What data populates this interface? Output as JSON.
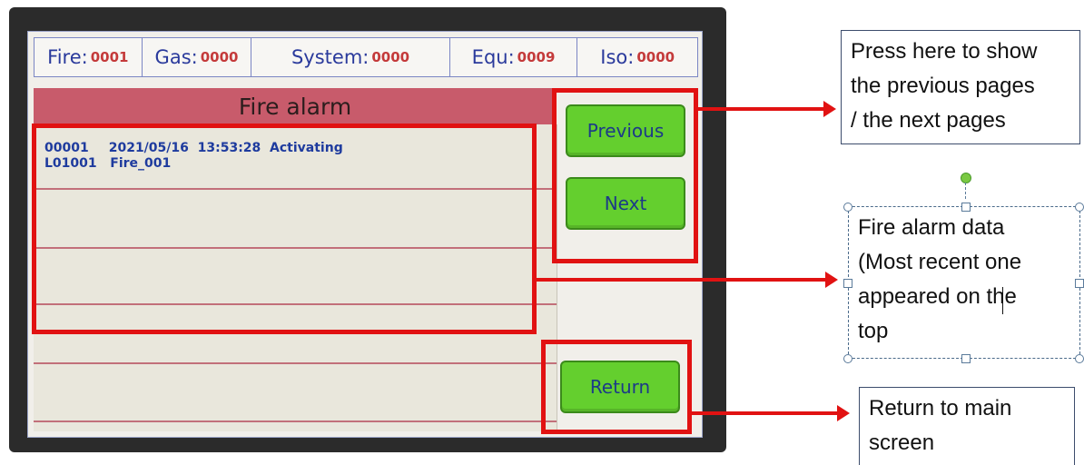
{
  "status_bar": {
    "fire": {
      "label": "Fire",
      "sep": ":",
      "value": "0001"
    },
    "gas": {
      "label": "Gas",
      "sep": ":",
      "value": "0000"
    },
    "system": {
      "label": "System",
      "sep": ":",
      "value": "0000"
    },
    "equ": {
      "label": "Equ",
      "sep": ":",
      "value": "0009"
    },
    "iso": {
      "label": "Iso",
      "sep": ":",
      "value": "0000"
    }
  },
  "panel": {
    "title": "Fire alarm",
    "entries": [
      {
        "id": "00001",
        "date": "2021/05/16",
        "time": "13:53:28",
        "state": "Activating",
        "location": "L01001",
        "name": "Fire_001"
      }
    ]
  },
  "buttons": {
    "previous": "Previous",
    "next": "Next",
    "return": "Return"
  },
  "callouts": {
    "paging": [
      "Press here to show",
      "the previous pages",
      "/ the next pages"
    ],
    "data": [
      "Fire alarm data",
      "(Most recent one",
      "appeared on the",
      "top"
    ],
    "return": [
      "Return to main",
      "screen"
    ]
  },
  "colors": {
    "annotation_red": "#e11212",
    "button_green": "#64cf2e",
    "title_bar": "#c85b6b",
    "value_red": "#c43a3a",
    "label_blue": "#2a3a9c"
  },
  "icons": {
    "connector": "red-arrow-icon",
    "rotate_handle": "rotate-handle-icon"
  }
}
